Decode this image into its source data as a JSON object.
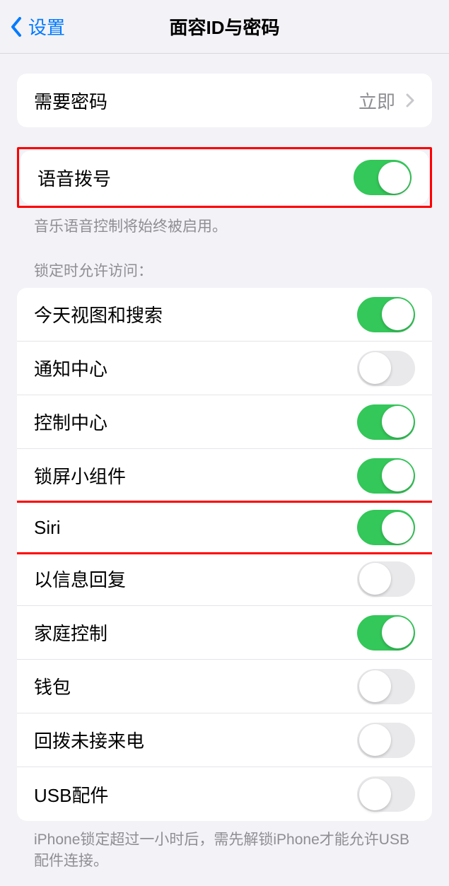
{
  "header": {
    "back_label": "设置",
    "title": "面容ID与密码"
  },
  "require_passcode": {
    "label": "需要密码",
    "value": "立即"
  },
  "voice_dial": {
    "label": "语音拨号",
    "on": true,
    "footer": "音乐语音控制将始终被启用。"
  },
  "locked_access": {
    "header": "锁定时允许访问：",
    "items": [
      {
        "label": "今天视图和搜索",
        "on": true
      },
      {
        "label": "通知中心",
        "on": false
      },
      {
        "label": "控制中心",
        "on": true
      },
      {
        "label": "锁屏小组件",
        "on": true
      },
      {
        "label": "Siri",
        "on": true
      },
      {
        "label": "以信息回复",
        "on": false
      },
      {
        "label": "家庭控制",
        "on": true
      },
      {
        "label": "钱包",
        "on": false
      },
      {
        "label": "回拨未接来电",
        "on": false
      },
      {
        "label": "USB配件",
        "on": false
      }
    ],
    "footer": "iPhone锁定超过一小时后，需先解锁iPhone才能允许USB配件连接。"
  }
}
